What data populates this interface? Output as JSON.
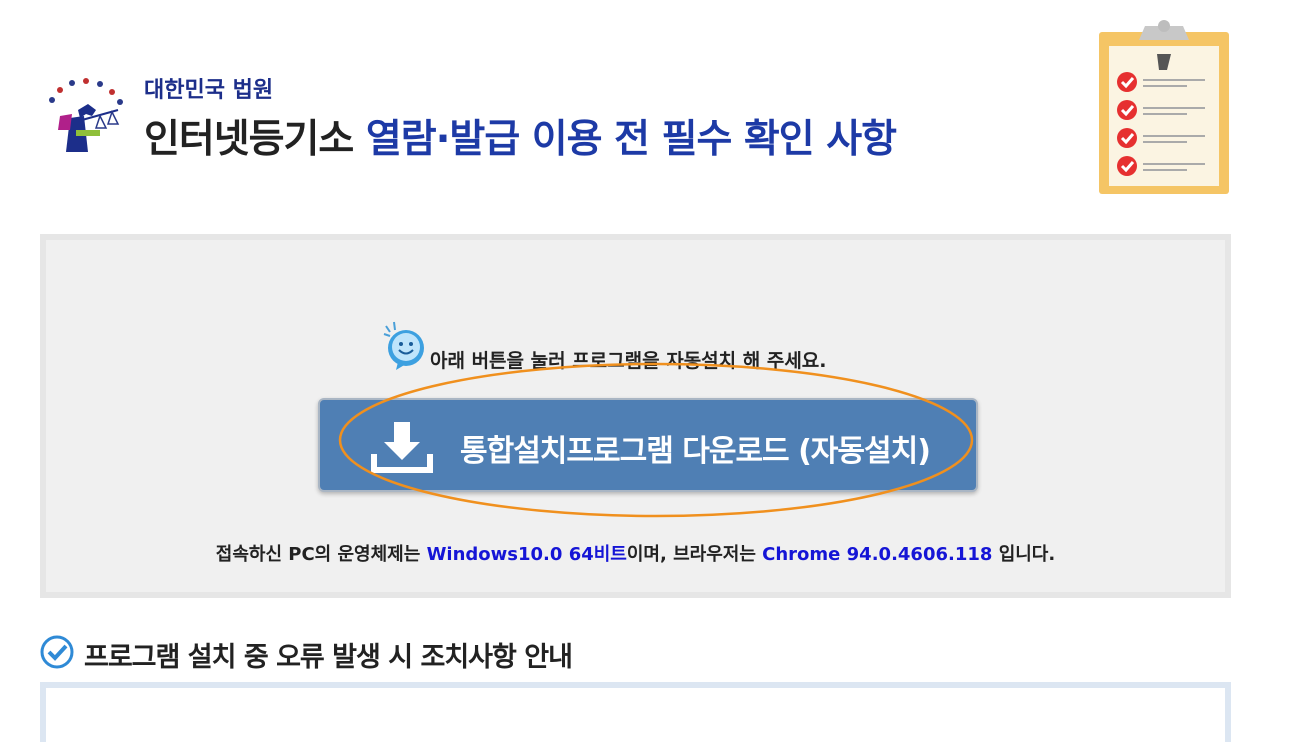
{
  "header": {
    "court_name": "대한민국 법원",
    "title_part1": "인터넷등기소 ",
    "title_part2": "열람·발급 이용 전 필수 확인 사항"
  },
  "install": {
    "notice": "아래 버튼을 눌러 프로그램을 자동설치 해 주세요.",
    "download_button_label": "통합설치프로그램 다운로드 (자동설치)"
  },
  "system_info": {
    "prefix": "접속하신 PC의 운영체제는 ",
    "os": "Windows10.0 64비트",
    "middle": "이며, 브라우저는 ",
    "browser": "Chrome 94.0.4606.118",
    "suffix": " 입니다."
  },
  "section": {
    "title": "프로그램 설치 중 오류 발생 시 조치사항 안내"
  },
  "colors": {
    "accent_blue": "#1d3aa6",
    "button_blue": "#4f7fb4",
    "highlight_orange": "#f0901e",
    "check_red": "#e63030"
  }
}
